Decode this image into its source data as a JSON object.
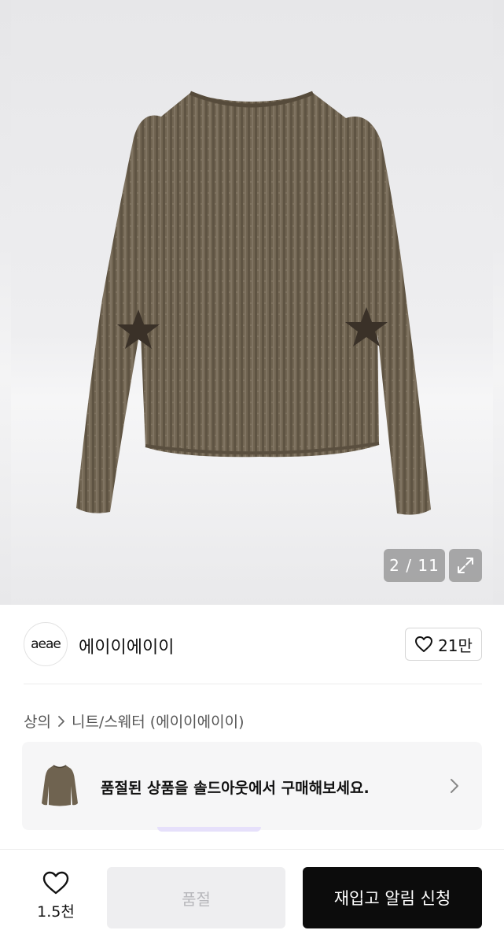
{
  "gallery": {
    "pager_text": "2 / 11",
    "current_index": 2,
    "total": 11,
    "expand_icon": "expand-icon"
  },
  "brand": {
    "logo_text": "aeae",
    "name": "에이이에이이",
    "like_count": "21만",
    "like_icon": "heart-icon"
  },
  "breadcrumb": {
    "items": [
      "상의",
      "니트/스웨터 (에이이에이이)"
    ],
    "separator_icon": "chevron-right-icon"
  },
  "soldout_banner": {
    "text": "품절된 상품을 솔드아웃에서 구매해보세요.",
    "chevron_icon": "chevron-right-icon"
  },
  "bottom_bar": {
    "wish_count": "1.5천",
    "wish_icon": "heart-icon",
    "soldout_label": "품절",
    "notify_label": "재입고 알림 신청"
  },
  "colors": {
    "sweater": "#6f6350",
    "notify_button_bg": "#0c0c0c",
    "soldout_button_bg": "#eeeef0"
  }
}
